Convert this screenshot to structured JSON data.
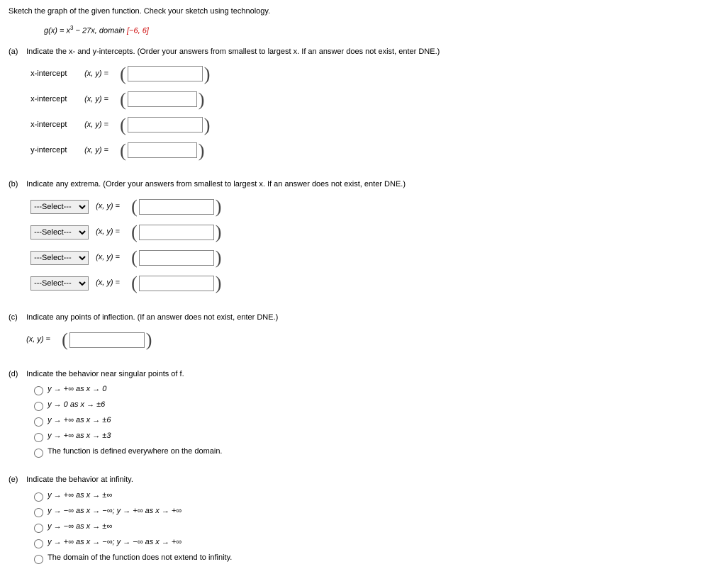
{
  "instruction": "Sketch the graph of the given function. Check your sketch using technology.",
  "function": {
    "name": "g",
    "var": "x",
    "expr_pre": "x",
    "expr_sup": "3",
    "expr_post": " − 27x, domain ",
    "domain": "[−6, 6]"
  },
  "parts": {
    "a": {
      "label": "(a)",
      "prompt": "Indicate the x- and y-intercepts. (Order your answers from smallest to largest x. If an answer does not exist, enter DNE.)",
      "rows": [
        {
          "label": "x-intercept",
          "xy": "(x, y)  ="
        },
        {
          "label": "x-intercept",
          "xy": "(x, y)  ="
        },
        {
          "label": "x-intercept",
          "xy": "(x, y)  ="
        },
        {
          "label": "y-intercept",
          "xy": "(x, y)  ="
        }
      ]
    },
    "b": {
      "label": "(b)",
      "prompt": "Indicate any extrema. (Order your answers from smallest to largest x. If an answer does not exist, enter DNE.)",
      "select_placeholder": "---Select---",
      "rows": [
        {
          "xy": "(x, y)  ="
        },
        {
          "xy": "(x, y)  ="
        },
        {
          "xy": "(x, y)  ="
        },
        {
          "xy": "(x, y)  ="
        }
      ]
    },
    "c": {
      "label": "(c)",
      "prompt": "Indicate any points of inflection. (If an answer does not exist, enter DNE.)",
      "xy": "(x, y)  ="
    },
    "d": {
      "label": "(d)",
      "prompt": "Indicate the behavior near singular points of f.",
      "options": [
        "y → +∞ as x → 0",
        "y → 0 as x → ±6",
        "y → +∞ as x → ±6",
        "y → +∞ as x → ±3",
        "The function is defined everywhere on the domain."
      ]
    },
    "e": {
      "label": "(e)",
      "prompt": "Indicate the behavior at infinity.",
      "options": [
        "y → +∞ as x → ±∞",
        "y → −∞ as x → −∞; y → +∞ as x → +∞",
        "y → −∞ as x → ±∞",
        "y → +∞ as x → −∞; y → −∞ as x → +∞",
        "The domain of the function does not extend to infinity."
      ]
    }
  }
}
